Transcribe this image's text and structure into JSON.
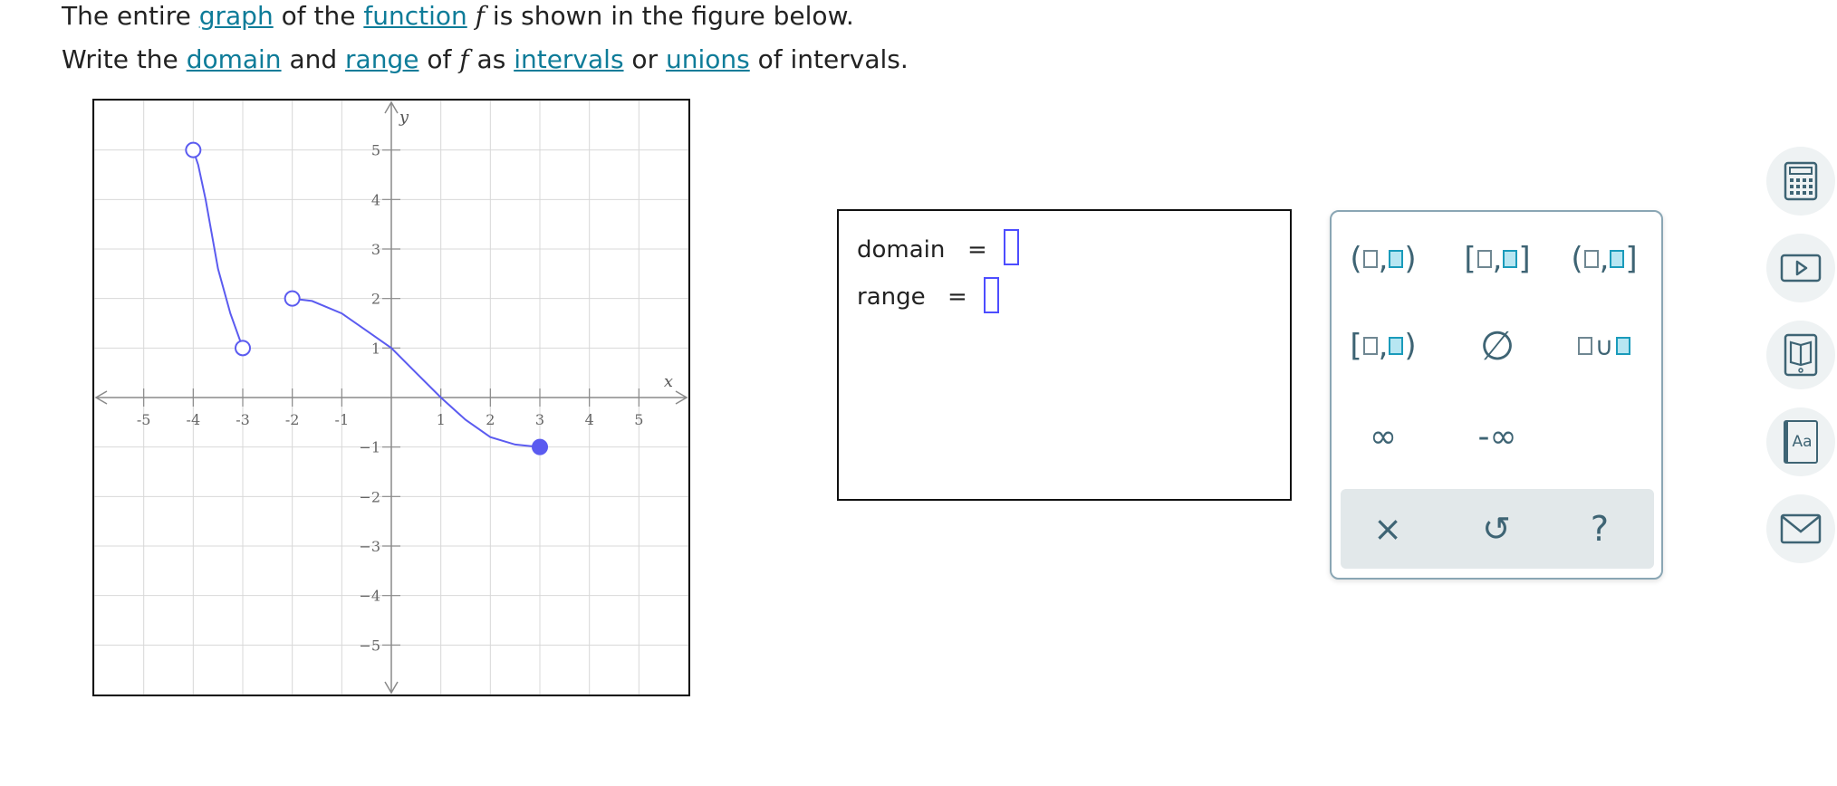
{
  "prompt": {
    "line1": {
      "t1": "The entire ",
      "l1": "graph",
      "t2": " of the ",
      "l2": "function",
      "fvar": "f",
      "t3": " is shown in the figure below."
    },
    "line2": {
      "t1": "Write the ",
      "l1": "domain",
      "t2": " and ",
      "l2": "range",
      "t3": " of ",
      "fvar": "f",
      "t4": " as ",
      "l3": "intervals",
      "t5": " or ",
      "l4": "unions",
      "t6": " of intervals."
    }
  },
  "answer": {
    "domain_label": "domain",
    "range_label": "range",
    "equals": "="
  },
  "keypad": {
    "ruler_glyph": "—",
    "empty_set": "∅",
    "union": "∪",
    "infinity": "∞",
    "neg_infinity": "-∞",
    "clear": "×",
    "undo": "↺",
    "help": "?",
    "open_paren": "(",
    "close_paren": ")",
    "open_bracket": "[",
    "close_bracket": "]",
    "comma": ","
  },
  "side_icons": [
    "calculator-icon",
    "video-icon",
    "book-icon",
    "glossary-icon",
    "mail-icon"
  ],
  "side_glossary_text": "Aa",
  "chart_data": {
    "type": "line",
    "xlabel": "x",
    "ylabel": "y",
    "xlim": [
      -6,
      6
    ],
    "ylim": [
      -6,
      6
    ],
    "x_ticks": [
      -5,
      -4,
      -3,
      -2,
      -1,
      1,
      2,
      3,
      4,
      5
    ],
    "y_ticks": [
      5,
      4,
      3,
      2,
      1,
      -1,
      -2,
      -3,
      -4,
      -5
    ],
    "grid": true,
    "color": "#5b5bf0",
    "series": [
      {
        "points": [
          [
            -4,
            5
          ],
          [
            -3.9,
            4.7
          ],
          [
            -3.75,
            4
          ],
          [
            -3.5,
            2.6
          ],
          [
            -3.25,
            1.7
          ],
          [
            -3,
            1
          ]
        ],
        "start": "open",
        "end": "open"
      },
      {
        "points": [
          [
            -2,
            2
          ],
          [
            -1.6,
            1.95
          ],
          [
            -1,
            1.7
          ],
          [
            -0.5,
            1.35
          ],
          [
            0,
            1
          ],
          [
            0.5,
            0.5
          ],
          [
            1,
            0
          ],
          [
            1.5,
            -0.45
          ],
          [
            2,
            -0.8
          ],
          [
            2.5,
            -0.95
          ],
          [
            3,
            -1
          ]
        ],
        "start": "open",
        "end": "closed"
      }
    ]
  }
}
